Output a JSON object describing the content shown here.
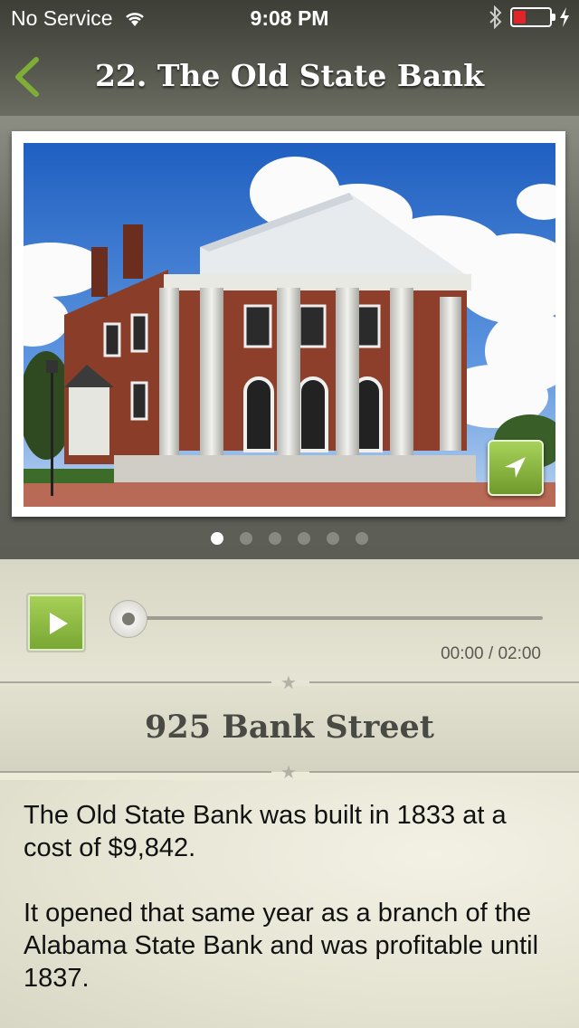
{
  "status": {
    "carrier": "No Service",
    "time": "9:08 PM",
    "battery_level": 0.35
  },
  "nav": {
    "title": "22. The Old State Bank",
    "back_icon": "chevron-left-icon",
    "accent_color": "#7eae38"
  },
  "gallery": {
    "page_count": 6,
    "active_page": 1,
    "map_button_icon": "location-arrow-icon"
  },
  "audio": {
    "play_icon": "play-icon",
    "progress": 0,
    "time_readout": "00:00 / 02:00"
  },
  "location": {
    "address": "925 Bank Street"
  },
  "description": {
    "paragraphs": [
      "The Old State Bank was built in 1833 at a cost of $9,842.",
      "It opened that same year as a branch of the Alabama State Bank and was profitable until 1837."
    ]
  }
}
